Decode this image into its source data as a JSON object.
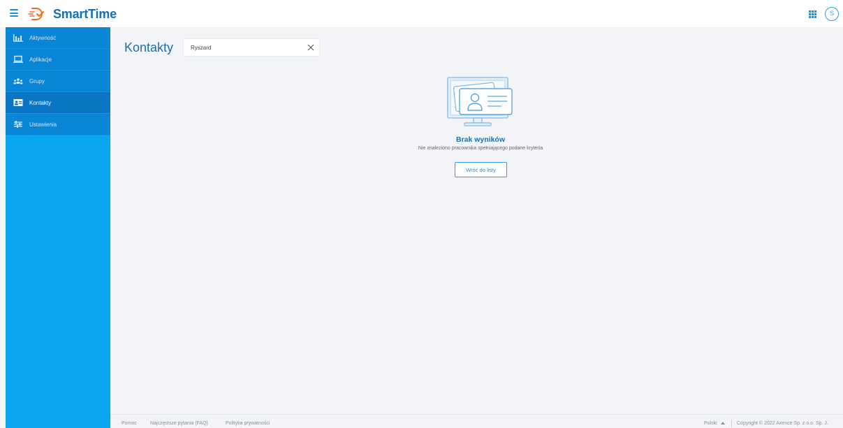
{
  "app": {
    "name": "SmartTime",
    "brand_color": "#1170b8",
    "accent_color": "#0aa6f0",
    "user_initial": "S"
  },
  "sidebar": {
    "items": [
      {
        "label": "Aktywność",
        "icon": "bar-chart-icon",
        "active": false
      },
      {
        "label": "Aplikacje",
        "icon": "laptop-icon",
        "active": false
      },
      {
        "label": "Grupy",
        "icon": "group-icon",
        "active": false
      },
      {
        "label": "Kontakty",
        "icon": "contact-card-icon",
        "active": true
      },
      {
        "label": "Ustawienia",
        "icon": "sliders-icon",
        "active": false
      }
    ]
  },
  "main": {
    "title": "Kontakty",
    "search": {
      "value": "Ryszard",
      "placeholder": ""
    },
    "empty_state": {
      "title": "Brak wyników",
      "subtitle": "Nie znaleziono pracownika spełniającego podane kryteria",
      "button_label": "Wróć do listy"
    }
  },
  "footer": {
    "links": [
      "Pomoc",
      "Najczęstsze pytania (FAQ)",
      "Polityka prywatności"
    ],
    "language": "Polski",
    "copyright": "Copyright © 2022 Axence Sp. z o.o. Sp. J."
  }
}
